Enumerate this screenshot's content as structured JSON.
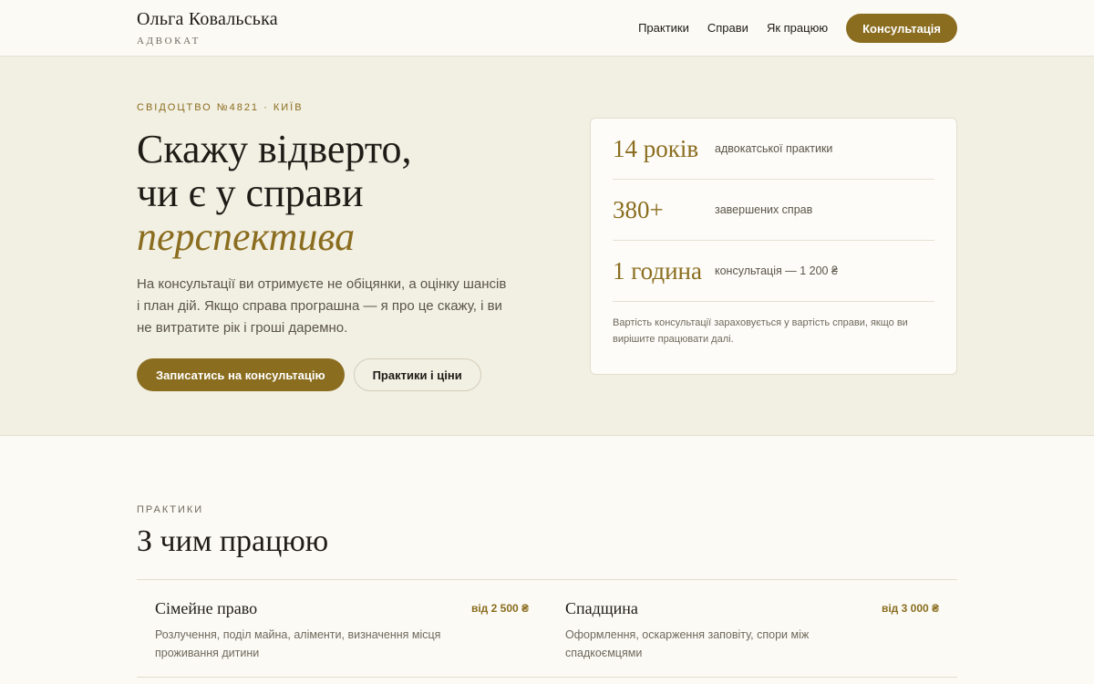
{
  "header": {
    "brand_name": "Ольга Ковальська",
    "brand_role": "АДВОКАТ",
    "nav": [
      "Практики",
      "Справи",
      "Як працюю"
    ],
    "cta": "Консультація"
  },
  "hero": {
    "eyebrow": "СВІДОЦТВО №4821 · КИЇВ",
    "title_line1": "Скажу відверто,",
    "title_line2": "чи є у справи",
    "title_accent": "перспектива",
    "lead": "На консультації ви отримуєте не обіцянки, а оцінку шансів і план дій. Якщо справа програшна — я про це скажу, і ви не витратите рік і гроші даремно.",
    "primary_button": "Записатись на консультацію",
    "secondary_button": "Практики і ціни"
  },
  "stats": {
    "items": [
      {
        "value": "14 років",
        "label": "адвокатської практики"
      },
      {
        "value": "380+",
        "label": "завершених справ"
      },
      {
        "value": "1 година",
        "label": "консультація — 1 200 ₴"
      }
    ],
    "note": "Вартість консультації зараховується у вартість справи, якщо ви вирішите працювати далі."
  },
  "practices": {
    "eyebrow": "ПРАКТИКИ",
    "title": "З чим працюю",
    "items": [
      {
        "name": "Сімейне право",
        "price": "від 2 500 ₴",
        "desc": "Розлучення, поділ майна, аліменти, визначення місця проживання дитини"
      },
      {
        "name": "Спадщина",
        "price": "від 3 000 ₴",
        "desc": "Оформлення, оскарження заповіту, спори між спадкоємцями"
      }
    ]
  },
  "colors": {
    "accent": "#8a6d1f",
    "hero_bg": "#f2efe3",
    "page_bg": "#fbfaf5"
  }
}
